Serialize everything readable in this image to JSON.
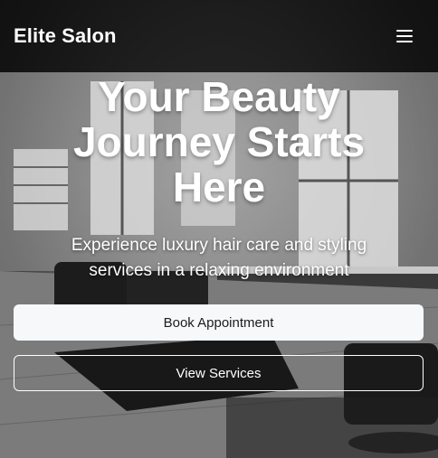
{
  "nav": {
    "brand": "Elite Salon",
    "menu_icon": "hamburger-menu-icon"
  },
  "hero": {
    "title": "Your Beauty Journey Starts Here",
    "subtitle": "Experience luxury hair care and styling services in a relaxing environment",
    "primary_button": "Book Appointment",
    "secondary_button": "View Services"
  },
  "colors": {
    "nav_background": "#0a0a0a",
    "primary_button_bg": "#f7f8fa",
    "text": "#ffffff"
  }
}
